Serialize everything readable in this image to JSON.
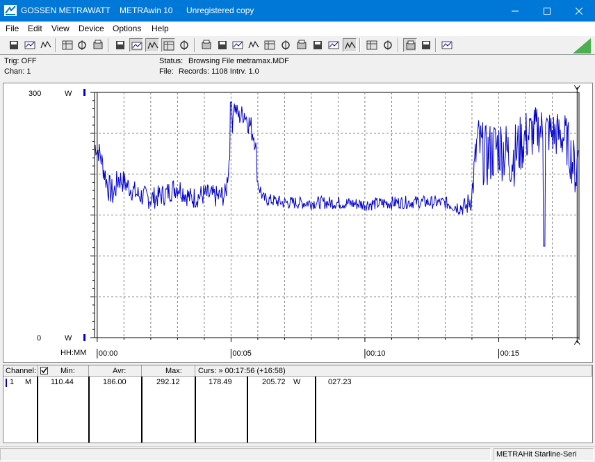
{
  "titlebar": {
    "app_brand": "GOSSEN METRAWATT",
    "app_name": "METRAwin 10",
    "registration": "Unregistered copy"
  },
  "menu": [
    "File",
    "Edit",
    "View",
    "Device",
    "Options",
    "Help"
  ],
  "toolbar_icons": [
    "save-icon",
    "save-as-icon",
    "open-folder-icon",
    "device-read-icon",
    "device-write-icon",
    "device-config-icon",
    "keyboard-icon",
    "waveform-icon",
    "crosshair-icon",
    "table-icon",
    "bar-graph-icon",
    "window-icon",
    "window2-icon",
    "list-icon",
    "computer-icon",
    "function-icon",
    "filter1-icon",
    "filter2-icon",
    "filter3-icon",
    "zoom-icon",
    "smile-icon",
    "print-icon",
    "print-preview-icon",
    "zoom-plot-icon",
    "zoom-back-icon",
    "message-icon"
  ],
  "status": {
    "trig": "Trig: OFF",
    "chan": "Chan:  1",
    "status_label": "Status:",
    "status_value": "Browsing File metramax.MDF",
    "file_label": "File:",
    "file_value": "Records: 1108   Intrv. 1.0"
  },
  "chart_data": {
    "type": "line",
    "series": [
      {
        "color": "#0000cc"
      }
    ],
    "ylim": [
      0,
      300
    ],
    "y_top_label": "300",
    "y_bottom_label": "0",
    "y_unit": "W",
    "x_axis_label": "HH:MM",
    "x_tick_labels": [
      "00:00",
      "00:05",
      "00:10",
      "00:15"
    ],
    "x_tick_minutes": [
      0,
      5,
      10,
      15
    ],
    "xlim_minutes": [
      -0.1,
      18.0
    ],
    "cursor_minutes": 17.93,
    "grid": true,
    "profile_minutes": [
      -0.1,
      0.1,
      0.4,
      0.6,
      0.8,
      1.0,
      1.5,
      2.0,
      2.5,
      3.0,
      3.5,
      4.0,
      4.5,
      4.8,
      5.0,
      5.1,
      5.3,
      5.5,
      5.7,
      5.9,
      6.0,
      6.2,
      6.5,
      7.0,
      8.0,
      9.0,
      10.0,
      11.0,
      12.0,
      13.0,
      13.5,
      13.8,
      14.0,
      14.2,
      14.5,
      15.0,
      15.5,
      16.0,
      16.5,
      17.0,
      17.5,
      17.9,
      18.0
    ],
    "profile_watts": [
      235,
      225,
      185,
      175,
      195,
      190,
      175,
      170,
      175,
      185,
      170,
      175,
      172,
      175,
      240,
      285,
      270,
      275,
      260,
      245,
      190,
      170,
      168,
      165,
      165,
      165,
      163,
      165,
      166,
      165,
      160,
      160,
      175,
      240,
      220,
      235,
      220,
      245,
      255,
      250,
      245,
      200,
      240
    ],
    "profile_noise": [
      10,
      15,
      18,
      18,
      16,
      15,
      14,
      14,
      14,
      14,
      14,
      14,
      14,
      14,
      16,
      10,
      12,
      14,
      16,
      18,
      12,
      8,
      8,
      8,
      8,
      8,
      8,
      8,
      8,
      8,
      10,
      12,
      20,
      35,
      40,
      40,
      40,
      35,
      30,
      30,
      30,
      35,
      30
    ]
  },
  "table": {
    "headers": {
      "channel": "Channel:",
      "min": "Min:",
      "avr": "Avr:",
      "max": "Max:",
      "curs": "Curs: » 00:17:56 (+16:58)"
    },
    "row": {
      "channel_num": "1",
      "channel_mode": "M",
      "min": "110.44",
      "avr": "186.00",
      "max": "292.12",
      "curs_a": "178.49",
      "curs_b": "205.72",
      "unit": "W",
      "curs_c": "027.23"
    }
  },
  "statusbar": {
    "device": "METRAHit Starline-Seri"
  }
}
